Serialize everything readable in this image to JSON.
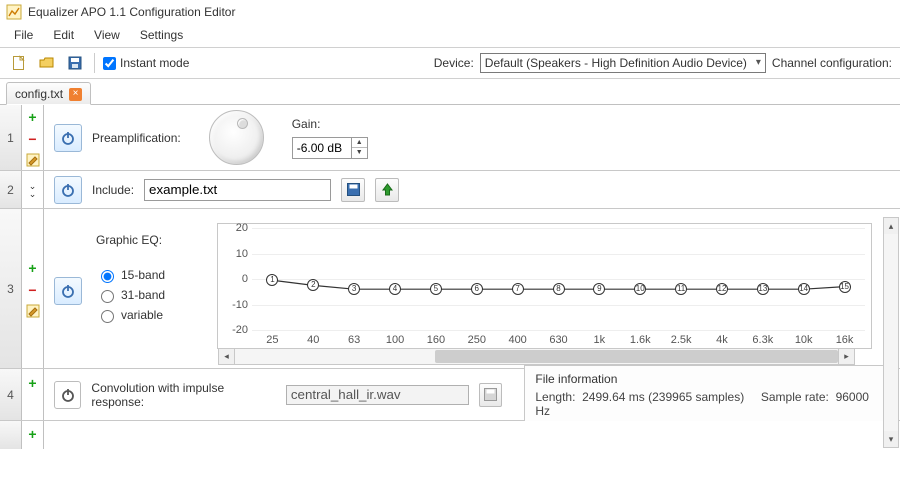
{
  "window": {
    "title": "Equalizer APO 1.1 Configuration Editor"
  },
  "menu": {
    "file": "File",
    "edit": "Edit",
    "view": "View",
    "settings": "Settings"
  },
  "toolbar": {
    "instant_mode_label": "Instant mode",
    "instant_mode_checked": true,
    "device_label": "Device:",
    "device_value": "Default (Speakers - High Definition Audio Device)",
    "channel_label": "Channel configuration:"
  },
  "tabs": [
    {
      "label": "config.txt"
    }
  ],
  "rows": {
    "1": {
      "label": "Preamplification:",
      "gain_label": "Gain:",
      "gain_value": "-6.00 dB"
    },
    "2": {
      "label": "Include:",
      "value": "example.txt"
    },
    "3": {
      "label": "Graphic EQ:",
      "radios": {
        "b15": "15-band",
        "b31": "31-band",
        "var": "variable"
      }
    },
    "4": {
      "label": "Convolution with impulse response:",
      "file": "central_hall_ir.wav",
      "fileinfo": {
        "header": "File information",
        "length_label": "Length:",
        "length_value": "2499.64 ms (239965 samples)",
        "rate_label": "Sample rate:",
        "rate_value": "96000 Hz"
      }
    }
  },
  "chart_data": {
    "type": "line",
    "title": "",
    "xlabel": "",
    "ylabel": "",
    "y_ticks": [
      20,
      10,
      0,
      -10,
      -20
    ],
    "ylim": [
      -20,
      20
    ],
    "x_ticks": [
      "25",
      "40",
      "63",
      "100",
      "160",
      "250",
      "400",
      "630",
      "1k",
      "1.6k",
      "2.5k",
      "4k",
      "6.3k",
      "10k",
      "16k"
    ],
    "categories": [
      "25",
      "40",
      "63",
      "100",
      "160",
      "250",
      "400",
      "630",
      "1k",
      "1.6k",
      "2.5k",
      "4k",
      "6.3k",
      "10k",
      "16k"
    ],
    "values": [
      -0.5,
      -2.5,
      -4,
      -4,
      -4,
      -4,
      -4,
      -4,
      -4,
      -4,
      -4,
      -4,
      -4,
      -4,
      -3
    ]
  }
}
